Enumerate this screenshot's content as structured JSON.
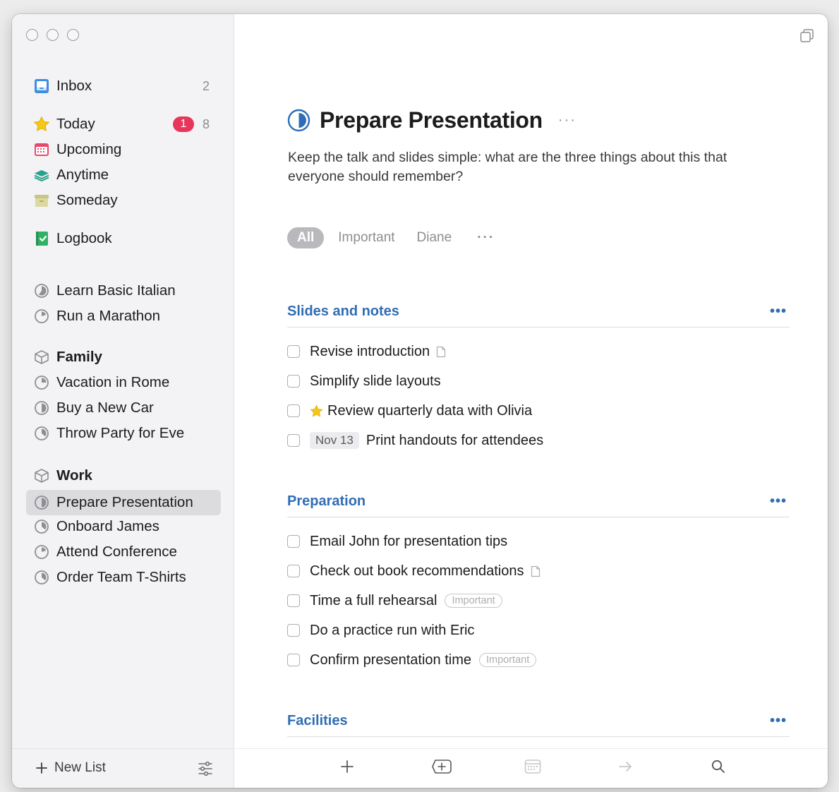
{
  "sidebar": {
    "inbox": {
      "label": "Inbox",
      "count": "2"
    },
    "today": {
      "label": "Today",
      "badge": "1",
      "count": "8"
    },
    "upcoming": {
      "label": "Upcoming"
    },
    "anytime": {
      "label": "Anytime"
    },
    "someday": {
      "label": "Someday"
    },
    "logbook": {
      "label": "Logbook"
    },
    "projects": [
      "Learn Basic Italian",
      "Run a Marathon"
    ],
    "areas": [
      {
        "name": "Family",
        "projects": [
          "Vacation in Rome",
          "Buy a New Car",
          "Throw Party for Eve"
        ]
      },
      {
        "name": "Work",
        "projects": [
          "Prepare Presentation",
          "Onboard James",
          "Attend Conference",
          "Order Team T-Shirts"
        ]
      }
    ],
    "new_list": "New List"
  },
  "project": {
    "title": "Prepare Presentation",
    "more": "···",
    "notes": "Keep the talk and slides simple: what are the three things about this that everyone should remember?",
    "tags": [
      "All",
      "Important",
      "Diane"
    ],
    "tags_more": "···"
  },
  "headings": [
    {
      "title": "Slides and notes",
      "todos": [
        {
          "title": "Revise introduction",
          "has_note": true
        },
        {
          "title": "Simplify slide layouts"
        },
        {
          "title": "Review quarterly data with Olivia",
          "starred": true
        },
        {
          "title": "Print handouts for attendees",
          "date": "Nov 13"
        }
      ]
    },
    {
      "title": "Preparation",
      "todos": [
        {
          "title": "Email John for presentation tips"
        },
        {
          "title": "Check out book recommendations",
          "has_note": true
        },
        {
          "title": "Time a full rehearsal",
          "tag": "Important"
        },
        {
          "title": "Do a practice run with Eric"
        },
        {
          "title": "Confirm presentation time",
          "tag": "Important"
        }
      ]
    },
    {
      "title": "Facilities",
      "todos": []
    }
  ],
  "heading_more": "•••",
  "colors": {
    "accent": "#2f6db5",
    "badge": "#e6375b",
    "today_star": "#f5c518"
  }
}
